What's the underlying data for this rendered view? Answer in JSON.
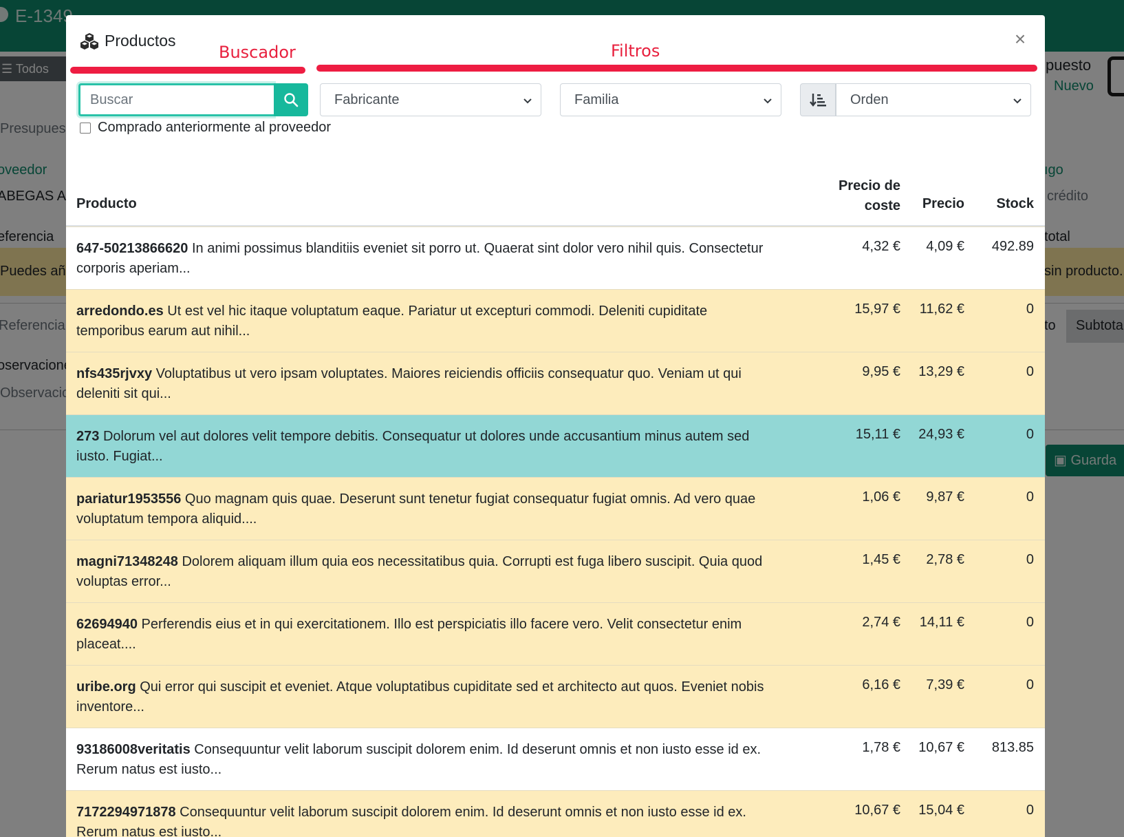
{
  "background": {
    "doc_code": "E-1349",
    "filter_button": "☰ Todos",
    "labels": {
      "presupuesto_left": "Presupues",
      "proveedor": "oveedor",
      "proveedor_value": "ABEGAS A",
      "referencia": "eferencia",
      "warning_left": "Puedes añ",
      "col_referencia": "Referencia",
      "observaciones": "oservacione",
      "observaciones_placeholder": "Observacio",
      "presupuesto_right": "puesto",
      "nuevo": "Nuevo",
      "pago": "ıgo",
      "credito": "crédito",
      "total": "total",
      "warning_right": "sin producto.",
      "col_to": "to",
      "col_subtotal": "Subtota",
      "save_button": "Guarda"
    }
  },
  "modal": {
    "title": "Productos",
    "close_label": "×",
    "annotations": {
      "search": "Buscador",
      "filters": "Filtros"
    },
    "search": {
      "placeholder": "Buscar",
      "value": ""
    },
    "filters": {
      "manufacturer": "Fabricante",
      "family": "Familia",
      "order": "Orden"
    },
    "checkbox_label": "Comprado anteriormente al proveedor",
    "checkbox_checked": false,
    "table": {
      "headers": {
        "product": "Producto",
        "cost_line1": "Precio de",
        "cost_line2": "coste",
        "price": "Precio",
        "stock": "Stock"
      },
      "rows": [
        {
          "code": "647-50213866620",
          "description": "In animi possimus blanditiis eveniet sit porro ut. Quaerat sint dolor vero nihil quis. Consectetur corporis aperiam...",
          "cost": "4,32 €",
          "price": "4,09 €",
          "stock": "492.89",
          "style": "white"
        },
        {
          "code": "arredondo.es",
          "description": "Ut est vel hic itaque voluptatum eaque. Pariatur ut excepturi commodi. Deleniti cupiditate temporibus earum aut nihil...",
          "cost": "15,97 €",
          "price": "11,62 €",
          "stock": "0",
          "style": "yellow"
        },
        {
          "code": "nfs435rjvxy",
          "description": "Voluptatibus ut vero ipsam voluptates. Maiores reiciendis officiis consequatur quo. Veniam ut qui deleniti sit qui...",
          "cost": "9,95 €",
          "price": "13,29 €",
          "stock": "0",
          "style": "yellow"
        },
        {
          "code": "273",
          "description": "Dolorum vel aut dolores velit tempore debitis. Consequatur ut dolores unde accusantium minus autem sed iusto. Fugiat...",
          "cost": "15,11 €",
          "price": "24,93 €",
          "stock": "0",
          "style": "teal"
        },
        {
          "code": "pariatur1953556",
          "description": "Quo magnam quis quae. Deserunt sunt tenetur fugiat consequatur fugiat omnis. Ad vero quae voluptatum tempora aliquid....",
          "cost": "1,06 €",
          "price": "9,87 €",
          "stock": "0",
          "style": "yellow"
        },
        {
          "code": "magni71348248",
          "description": "Dolorem aliquam illum quia eos necessitatibus quia. Corrupti est fuga libero suscipit. Quia quod voluptas error...",
          "cost": "1,45 €",
          "price": "2,78 €",
          "stock": "0",
          "style": "yellow"
        },
        {
          "code": "62694940",
          "description": "Perferendis eius et in qui exercitationem. Illo est perspiciatis illo facere vero. Velit consectetur enim placeat....",
          "cost": "2,74 €",
          "price": "14,11 €",
          "stock": "0",
          "style": "yellow"
        },
        {
          "code": "uribe.org",
          "description": "Qui error qui suscipit et eveniet. Atque voluptatibus cupiditate sed et architecto aut quos. Eveniet nobis inventore...",
          "cost": "6,16 €",
          "price": "7,39 €",
          "stock": "0",
          "style": "yellow"
        },
        {
          "code": "93186008veritatis",
          "description": "Consequuntur velit laborum suscipit dolorem enim. Id deserunt omnis et non iusto esse id ex. Rerum natus est iusto...",
          "cost": "1,78 €",
          "price": "10,67 €",
          "stock": "813.85",
          "style": "white"
        },
        {
          "code": "7172294971878",
          "description": "Consequuntur velit laborum suscipit dolorem enim. Id deserunt omnis et non iusto esse id ex. Rerum natus est iusto...",
          "cost": "10,67 €",
          "price": "15,04 €",
          "stock": "0",
          "style": "yellow"
        }
      ]
    }
  },
  "colors": {
    "brand_green": "#0f8a6c",
    "search_button": "#17b89c",
    "annotation_red": "#ee1d42",
    "row_warning": "#fdecbc",
    "row_selected": "#92d7d5"
  }
}
